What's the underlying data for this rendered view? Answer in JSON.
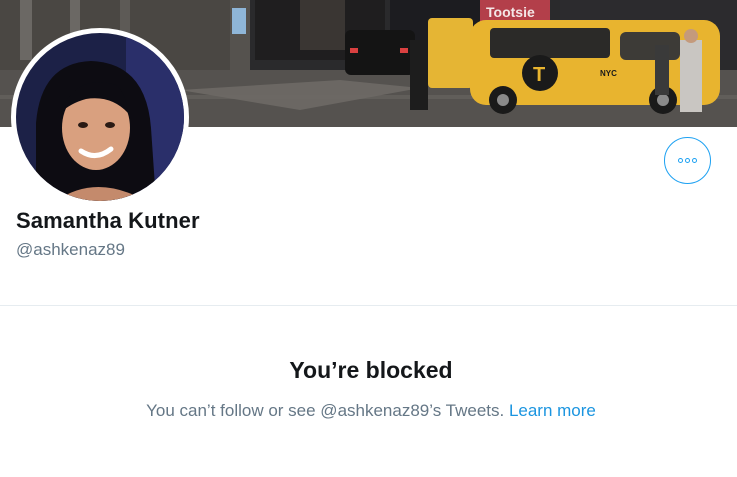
{
  "profile": {
    "name": "Samantha Kutner",
    "handle": "@ashkenaz89"
  },
  "banner": {
    "storefront_sign": "Tootsie",
    "taxi_marking": "NYC"
  },
  "actions": {
    "more_icon": "more-horizontal-icon"
  },
  "blocked": {
    "title": "You’re blocked",
    "message": "You can’t follow or see @ashkenaz89’s Tweets. ",
    "link": "Learn more"
  },
  "colors": {
    "accent": "#1da1f2",
    "link": "#1b95e0",
    "primary_text": "#14171a",
    "secondary_text": "#657786",
    "divider": "#e6ecf0"
  }
}
